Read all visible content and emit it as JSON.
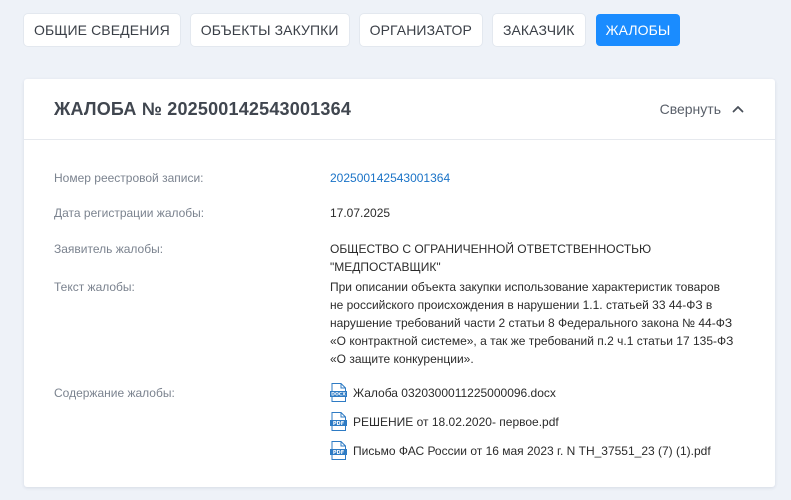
{
  "tabs": [
    {
      "label": "ОБЩИЕ СВЕДЕНИЯ",
      "active": false
    },
    {
      "label": "ОБЪЕКТЫ ЗАКУПКИ",
      "active": false
    },
    {
      "label": "ОРГАНИЗАТОР",
      "active": false
    },
    {
      "label": "ЗАКАЗЧИК",
      "active": false
    },
    {
      "label": "ЖАЛОБЫ",
      "active": true
    }
  ],
  "card": {
    "title": "ЖАЛОБА № 202500142543001364",
    "collapse_label": "Свернуть",
    "fields": {
      "registry_number": {
        "label": "Номер реестровой записи:",
        "value": "202500142543001364"
      },
      "registration_date": {
        "label": "Дата регистрации жалобы:",
        "value": "17.07.2025"
      },
      "applicant": {
        "label": "Заявитель жалобы:",
        "value": "ОБЩЕСТВО С ОГРАНИЧЕННОЙ ОТВЕТСТВЕННОСТЬЮ \"МЕДПОСТАВЩИК\""
      },
      "text": {
        "label": "Текст жалобы:",
        "lines": [
          "При описании объекта закупки использование характеристик товаров",
          "не российского происхождения в нарушении 1.1. статьей 33 44-ФЗ в",
          "нарушение требований части 2 статьи 8 Федерального закона № 44-ФЗ",
          "«О контрактной системе», а так же требований п.2 ч.1 статьи 17 135-ФЗ",
          "«О защите конкуренции»."
        ]
      },
      "content": {
        "label": "Содержание жалобы:",
        "files": [
          {
            "name": "Жалоба 0320300011225000096.docx",
            "type": "DOCX"
          },
          {
            "name": "РЕШЕНИЕ от 18.02.2020- первое.pdf",
            "type": "PDF"
          },
          {
            "name": "Письмо ФАС России от 16 мая 2023 г. N ТН_37551_23 (7) (1).pdf",
            "type": "PDF"
          }
        ]
      }
    }
  },
  "colors": {
    "accent": "#1a8cff",
    "link": "#1a73c7",
    "background": "#eef2f8"
  }
}
